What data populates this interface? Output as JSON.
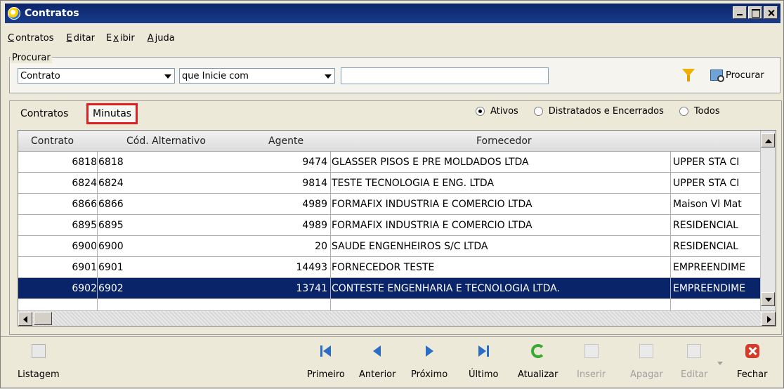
{
  "window": {
    "title": "Contratos"
  },
  "menu": [
    {
      "label": "Contratos"
    },
    {
      "label": "Editar"
    },
    {
      "label": "Exibir"
    },
    {
      "label": "Ajuda"
    }
  ],
  "search": {
    "group_label": "Procurar",
    "field_value": "Contrato",
    "operator_value": "que Inicie com",
    "text_value": "",
    "button_label": "Procurar"
  },
  "tabs": [
    {
      "label": "Contratos"
    },
    {
      "label": "Minutas"
    }
  ],
  "filters": [
    {
      "label": "Ativos",
      "checked": true
    },
    {
      "label": "Distratados e Encerrados",
      "checked": false
    },
    {
      "label": "Todos",
      "checked": false
    }
  ],
  "grid": {
    "columns": [
      "Contrato",
      "Cód. Alternativo",
      "Agente",
      "Fornecedor"
    ],
    "rows": [
      [
        "6818",
        "6818",
        "9474",
        "GLASSER PISOS E PRE MOLDADOS LTDA",
        "UPPER STA CI"
      ],
      [
        "6824",
        "6824",
        "9814",
        "TESTE TECNOLOGIA E ENG. LTDA",
        "UPPER STA CI"
      ],
      [
        "6866",
        "6866",
        "4989",
        "FORMAFIX INDUSTRIA E COMERCIO LTDA",
        "Maison Vl Mat"
      ],
      [
        "6895",
        "6895",
        "4989",
        "FORMAFIX INDUSTRIA E COMERCIO LTDA",
        "RESIDENCIAL"
      ],
      [
        "6900",
        "6900",
        "20",
        "SAUDE ENGENHEIROS S/C LTDA",
        "RESIDENCIAL"
      ],
      [
        "6901",
        "6901",
        "14493",
        "FORNECEDOR TESTE",
        "EMPREENDIME"
      ],
      [
        "6902",
        "6902",
        "13741",
        "CONTESTE ENGENHARIA E TECNOLOGIA LTDA.",
        "EMPREENDIME"
      ]
    ],
    "selected_row": 6
  },
  "toolbar": {
    "listagem": "Listagem",
    "primeiro": "Primeiro",
    "anterior": "Anterior",
    "proximo": "Próximo",
    "ultimo": "Último",
    "atualizar": "Atualizar",
    "inserir": "Inserir",
    "apagar": "Apagar",
    "editar": "Editar",
    "fechar": "Fechar"
  }
}
